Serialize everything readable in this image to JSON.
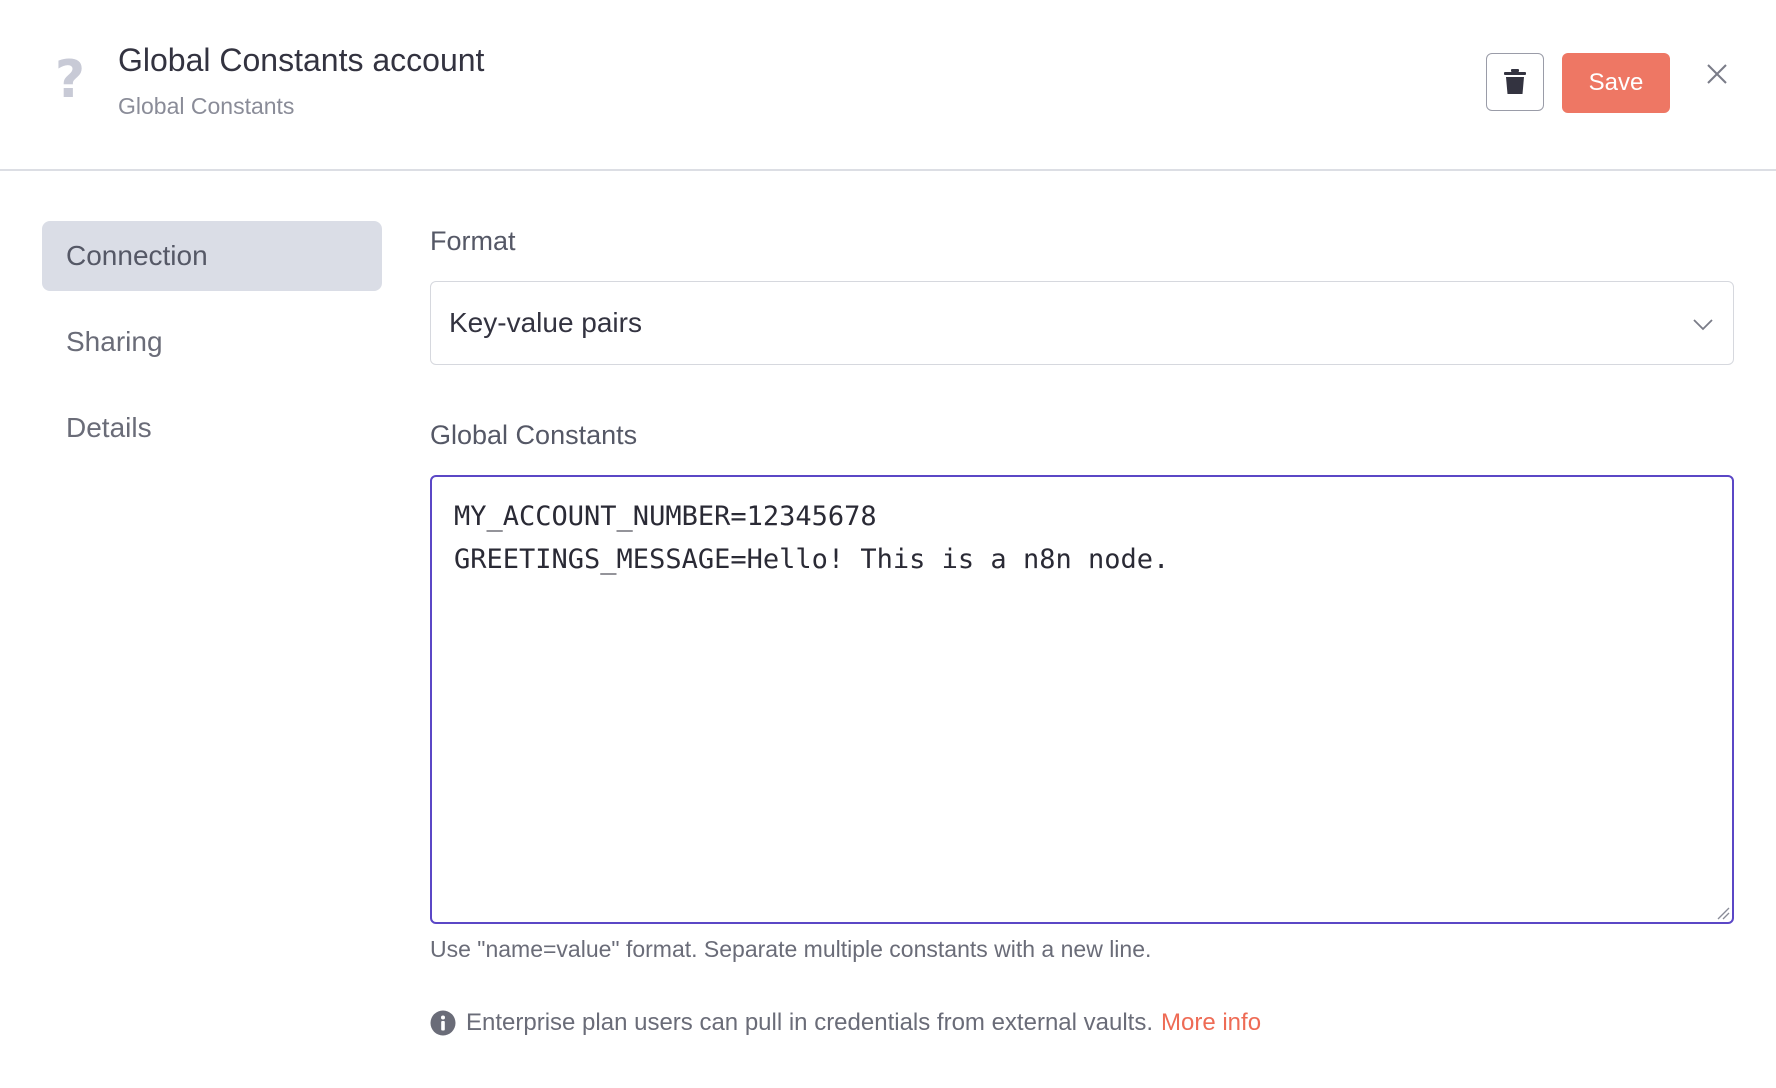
{
  "header": {
    "title": "Global Constants account",
    "subtitle": "Global Constants",
    "icon": "question-mark-icon",
    "delete_icon": "trash-icon",
    "save_label": "Save",
    "close_icon": "close-icon",
    "accent_color": "#ee7764"
  },
  "sidebar": {
    "items": [
      {
        "label": "Connection",
        "active": true
      },
      {
        "label": "Sharing",
        "active": false
      },
      {
        "label": "Details",
        "active": false
      }
    ]
  },
  "main": {
    "format": {
      "label": "Format",
      "value": "Key-value pairs"
    },
    "constants": {
      "label": "Global Constants",
      "value": "MY_ACCOUNT_NUMBER=12345678\nGREETINGS_MESSAGE=Hello! This is a n8n node.",
      "hint": "Use \"name=value\" format. Separate multiple constants with a new line."
    },
    "info": {
      "text": "Enterprise plan users can pull in credentials from external vaults.",
      "link_label": "More info",
      "link_color": "#ee6b55"
    }
  }
}
